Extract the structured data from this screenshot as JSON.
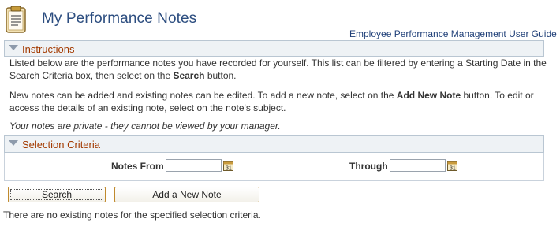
{
  "header": {
    "title": "My Performance Notes",
    "guide_link": "Employee Performance Management User Guide",
    "icon": "notepad-icon"
  },
  "instructions": {
    "heading": "Instructions",
    "para1_a": "Listed below are the performance notes you have recorded for yourself. This list can be filtered by entering a Starting Date in the Search Criteria box, then select on the ",
    "para1_bold": "Search",
    "para1_b": " button.",
    "para2_a": "New notes can be added and existing notes can be edited. To add a new note, select on the ",
    "para2_bold": "Add New Note",
    "para2_b": " button. To edit or access the details of an existing note, select on the note's subject.",
    "privacy_note": "Your notes are private - they cannot be viewed by your manager."
  },
  "criteria": {
    "heading": "Selection Criteria",
    "from_label": "Notes From",
    "from_value": "",
    "through_label": "Through",
    "through_value": "",
    "calendar_icon": "calendar-icon"
  },
  "actions": {
    "search_label": "Search",
    "add_label": "Add a New Note"
  },
  "status": {
    "message": "There are no existing notes for the specified selection criteria."
  }
}
